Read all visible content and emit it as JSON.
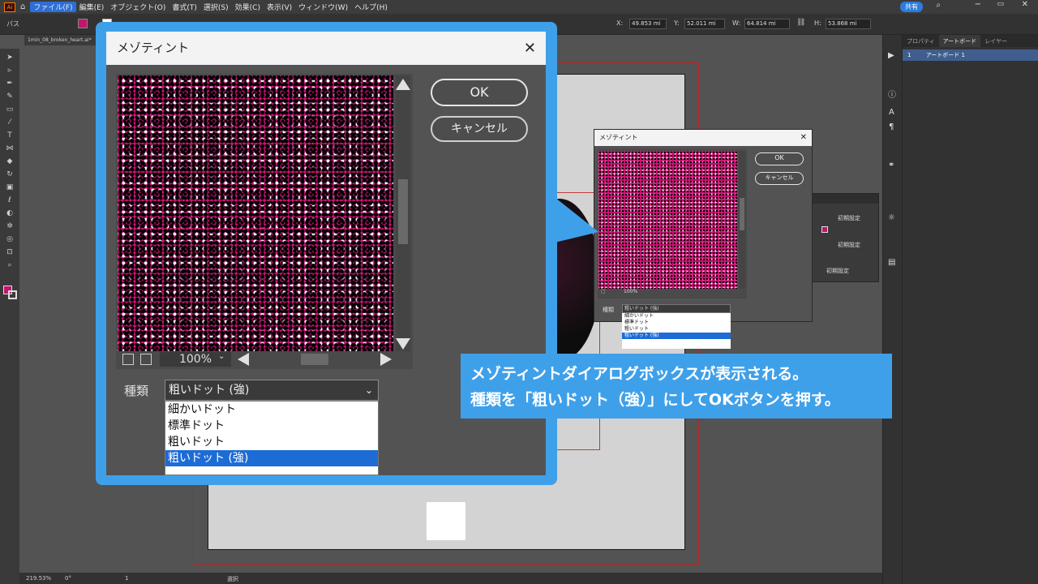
{
  "menubar": {
    "items": [
      "ファイル(F)",
      "編集(E)",
      "オブジェクト(O)",
      "書式(T)",
      "選択(S)",
      "効果(C)",
      "表示(V)",
      "ウィンドウ(W)",
      "ヘルプ(H)"
    ],
    "share_label": "共有"
  },
  "controlbar": {
    "path_label": "パス",
    "x_label": "X:",
    "x_value": "49.853 mi",
    "y_label": "Y:",
    "y_value": "52.011 mi",
    "w_label": "W:",
    "w_value": "64.814 mi",
    "h_label": "H:",
    "h_value": "53.868 mi",
    "fill_color": "#c2156f"
  },
  "document": {
    "tab_title": "1min_08_broken_heart.ai*"
  },
  "right_panel": {
    "tabs": [
      "プロパティ",
      "アートボード",
      "レイヤー"
    ],
    "artboard_num": "1",
    "artboard_name": "アートボード 1"
  },
  "appearance_panel": {
    "label1": "初期設定",
    "label2": "初期設定",
    "label3": "初期設定"
  },
  "status": {
    "zoom": "219.53%",
    "rotation": "0°",
    "page": "1",
    "mode": "選択"
  },
  "mezzotint_large": {
    "title": "メゾティント",
    "ok_label": "OK",
    "cancel_label": "キャンセル",
    "zoom": "100%",
    "type_label": "種類",
    "type_value": "粗いドット (強)",
    "options": [
      "細かいドット",
      "標準ドット",
      "粗いドット",
      "粗いドット (強)"
    ],
    "selected_index": 3
  },
  "mezzotint_small": {
    "title": "メゾティント",
    "ok_label": "OK",
    "cancel_label": "キャンセル",
    "zoom": "100%",
    "type_label": "種類",
    "type_value": "粗いドット (強)",
    "options": [
      "細かいドット",
      "標準ドット",
      "粗いドット",
      "粗いドット (強)"
    ]
  },
  "callout": {
    "line1": "メゾティントダイアログボックスが表示される。",
    "line2": "種類を「粗いドット（強）」にしてOKボタンを押す。"
  },
  "colors": {
    "accent_blue": "#3fa0ea",
    "magenta": "#d4137a",
    "selection_blue": "#1d6cd6"
  }
}
